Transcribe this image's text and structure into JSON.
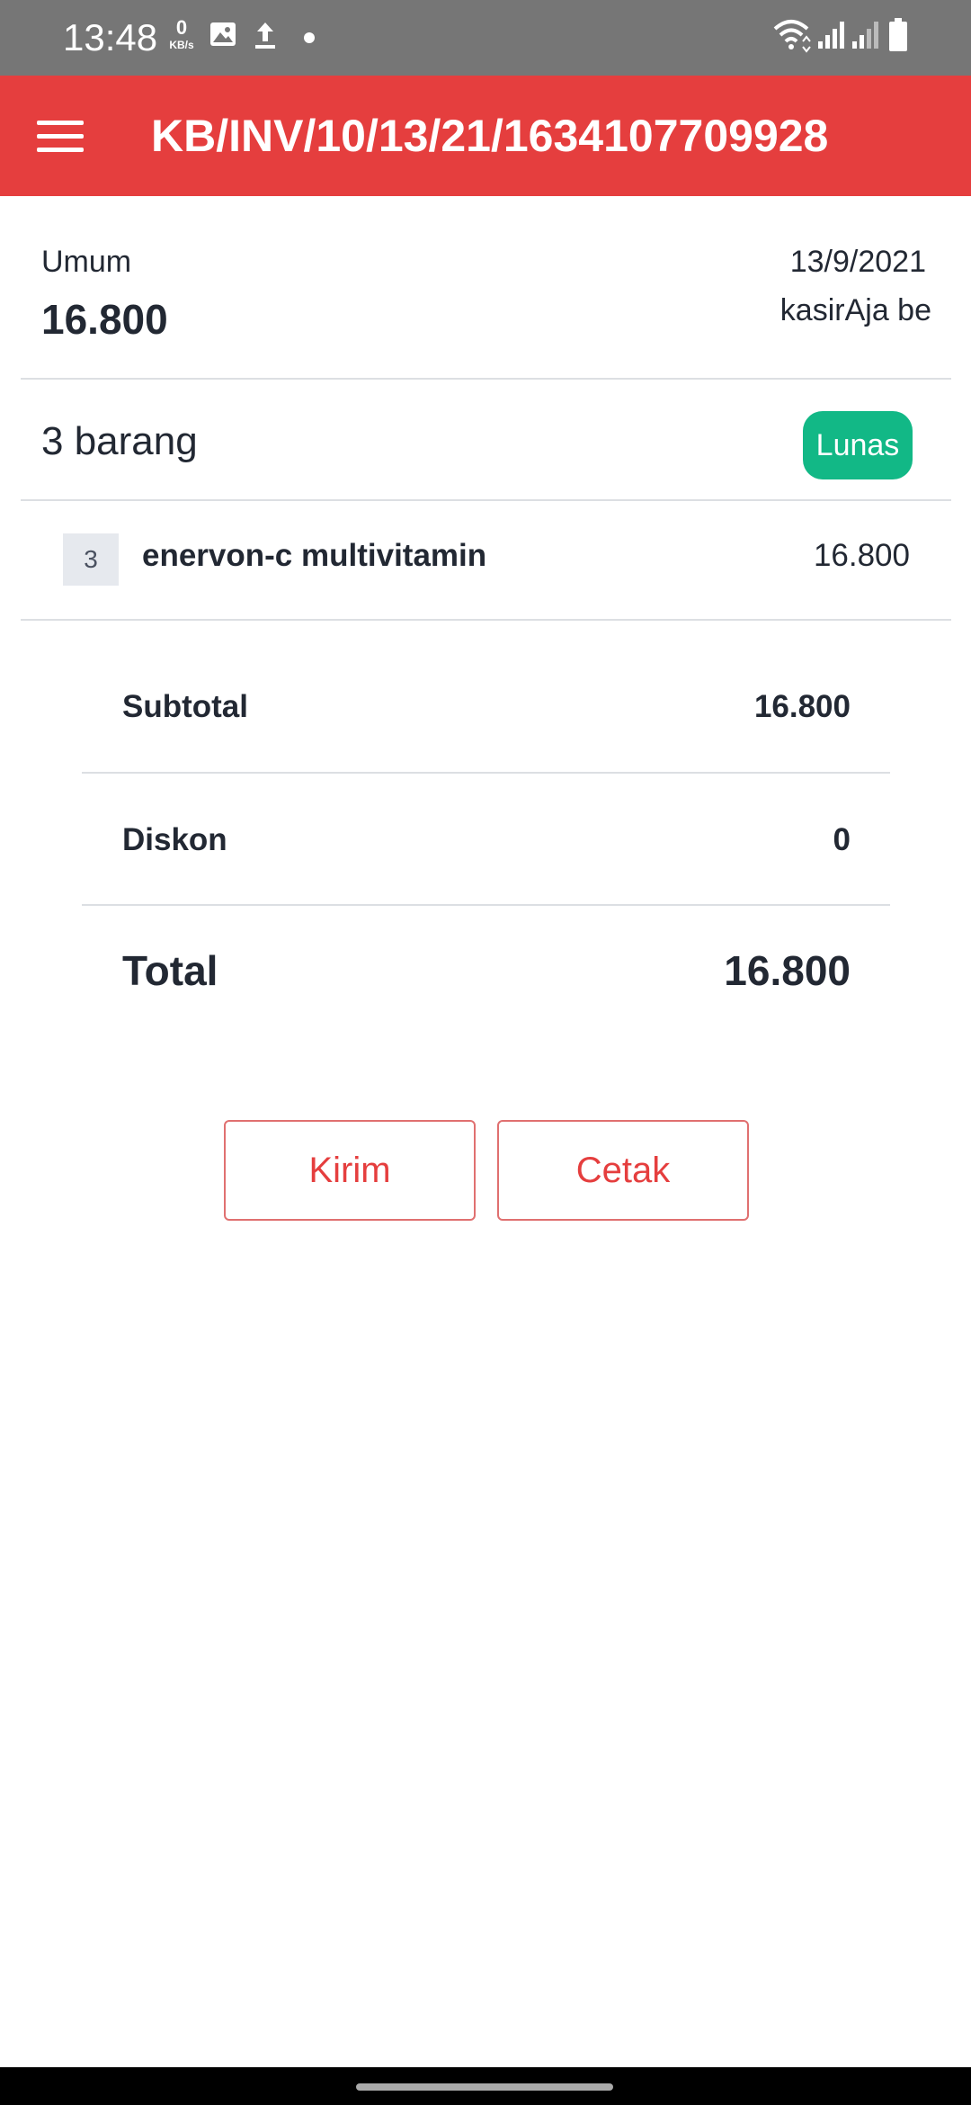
{
  "status_bar": {
    "time": "13:48",
    "speed_value": "0",
    "speed_unit": "KB/s",
    "icons": [
      "gallery-icon",
      "upload-icon",
      "dot-icon",
      "wifi-icon",
      "signal-icon",
      "signal-icon",
      "battery-icon"
    ]
  },
  "app_bar": {
    "title": "KB/INV/10/13/21/1634107709928",
    "menu_icon": "hamburger-menu-icon",
    "color": "#e53e3e"
  },
  "invoice": {
    "customer": "Umum",
    "amount": "16.800",
    "date": "13/9/2021",
    "cashier": "kasirAja be",
    "items_count": "3 barang",
    "status": "Lunas",
    "status_color": "#12b886"
  },
  "items": [
    {
      "qty": "3",
      "name": "enervon-c multivitamin",
      "price": "16.800"
    }
  ],
  "summary": {
    "subtotal_label": "Subtotal",
    "subtotal_value": "16.800",
    "discount_label": "Diskon",
    "discount_value": "0",
    "total_label": "Total",
    "total_value": "16.800"
  },
  "actions": {
    "send_label": "Kirim",
    "print_label": "Cetak"
  }
}
